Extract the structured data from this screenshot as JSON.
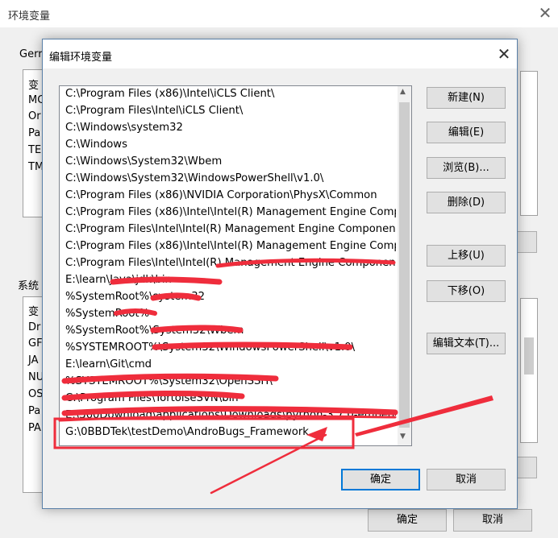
{
  "background_window": {
    "title": "环境变量",
    "user_group_fragment": "Gerr",
    "user_rows": [
      "变",
      "MC",
      "Or",
      "Pa",
      "TE",
      "TM"
    ],
    "system_label": "系统",
    "system_rows": [
      "变",
      "Dr",
      "GF",
      "JA",
      "NU",
      "OS",
      "Pa",
      "PA"
    ],
    "ok_label": "确定",
    "cancel_label": "取消"
  },
  "dialog": {
    "title": "编辑环境变量",
    "paths": [
      "C:\\Program Files (x86)\\Intel\\iCLS Client\\",
      "C:\\Program Files\\Intel\\iCLS Client\\",
      "C:\\Windows\\system32",
      "C:\\Windows",
      "C:\\Windows\\System32\\Wbem",
      "C:\\Windows\\System32\\WindowsPowerShell\\v1.0\\",
      "C:\\Program Files (x86)\\NVIDIA Corporation\\PhysX\\Common",
      "C:\\Program Files (x86)\\Intel\\Intel(R) Management Engine Comp...",
      "C:\\Program Files\\Intel\\Intel(R) Management Engine Componen...",
      "C:\\Program Files (x86)\\Intel\\Intel(R) Management Engine Comp...",
      "C:\\Program Files\\Intel\\Intel(R) Management Engine Componen...",
      "E:\\learn\\Java\\jdk\\bin",
      "%SystemRoot%\\system32",
      "%SystemRoot%",
      "%SystemRoot%\\System32\\Wbem",
      "%SYSTEMROOT%\\System32\\WindowsPowerShell\\v1.0\\",
      "E:\\learn\\Git\\cmd",
      "%SYSTEMROOT%\\System32\\OpenSSH\\",
      "C:\\Program Files\\TortoiseSVN\\bin",
      "E:\\360Download\\applications\\Downloads\\python-3.7.0-embed-a",
      "G:\\0BBDTek\\testDemo\\AndroBugs_Framework"
    ],
    "buttons": {
      "new": "新建(N)",
      "edit": "编辑(E)",
      "browse": "浏览(B)...",
      "delete": "删除(D)",
      "move_up": "上移(U)",
      "move_down": "下移(O)",
      "edit_text": "编辑文本(T)...",
      "ok": "确定",
      "cancel": "取消"
    }
  },
  "colors": {
    "annotation_red": "#ef2d3c",
    "focus_blue": "#0078d7"
  },
  "icons": [
    "close-icon",
    "scroll-up-arrow-icon",
    "scroll-down-arrow-icon"
  ]
}
